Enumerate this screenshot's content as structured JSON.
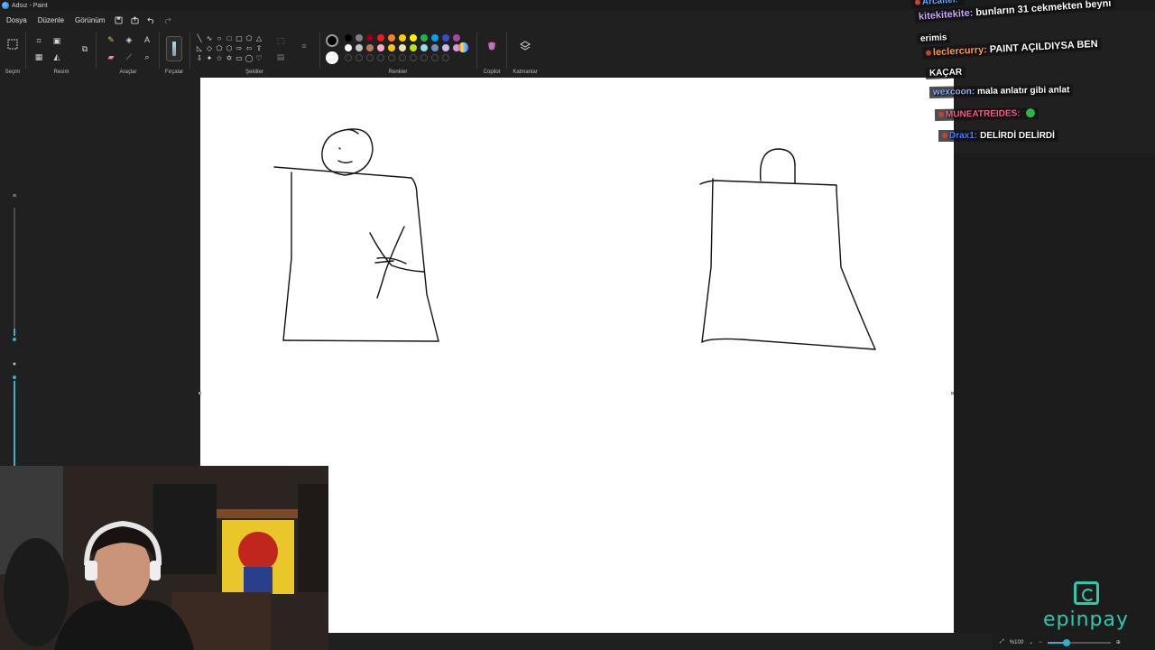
{
  "window": {
    "title": "Adsız - Paint"
  },
  "menu": {
    "items": [
      "Dosya",
      "Düzenle",
      "Görünüm"
    ],
    "icons": [
      "save-icon",
      "share-icon",
      "undo-icon",
      "redo-icon"
    ]
  },
  "ribbon": {
    "groups": {
      "selection": "Seçim",
      "image": "Resim",
      "tools": "Araçlar",
      "brushes": "Fırçalar",
      "shapes": "Şekiller",
      "colors": "Renkler",
      "copilot": "Copilot",
      "layers": "Katmanlar"
    },
    "text_tool": "A",
    "palette_row1": [
      "#000000",
      "#7f7f7f",
      "#880015",
      "#ed1c24",
      "#ff7f27",
      "#ffc90e",
      "#fff200",
      "#22b14c",
      "#00a2e8",
      "#3f48cc",
      "#a349a4"
    ],
    "palette_row2": [
      "#ffffff",
      "#c3c3c3",
      "#b97a57",
      "#ffaec9",
      "#ffc90e",
      "#efe4b0",
      "#b5e61d",
      "#99d9ea",
      "#7092be",
      "#c8bfe7",
      "#c8a2e7"
    ],
    "primary_color": "#000000",
    "secondary_color": "#ffffff"
  },
  "chat": [
    {
      "user": "Arcaitel:",
      "text": "",
      "user_color": "#6fa8ff"
    },
    {
      "user": "kitekitekite:",
      "text": "bunların 31 cekmekten beyni",
      "user_color": "#c9a7ff"
    },
    {
      "user": "",
      "text": "erimis",
      "user_color": "#ffffff"
    },
    {
      "user": "leclercurry:",
      "text": "PAINT AÇILDIYSA BEN",
      "user_color": "#ff9e3d"
    },
    {
      "user": "",
      "text": "KAÇAR",
      "user_color": "#ffffff"
    },
    {
      "user": "wexcoon:",
      "text": "mala anlatır gibi anlat",
      "user_color": "#8fb3ff"
    },
    {
      "user": "MUNEATREIDES:",
      "text": "",
      "user_color": "#ff5c8a"
    },
    {
      "user": "Drax1:",
      "text": "DELİRDİ DELİRDİ",
      "user_color": "#4f7bff"
    }
  ],
  "logo": {
    "text": "epinpay"
  },
  "status": {
    "zoom": "%100",
    "zoom_fraction": 0.3
  }
}
